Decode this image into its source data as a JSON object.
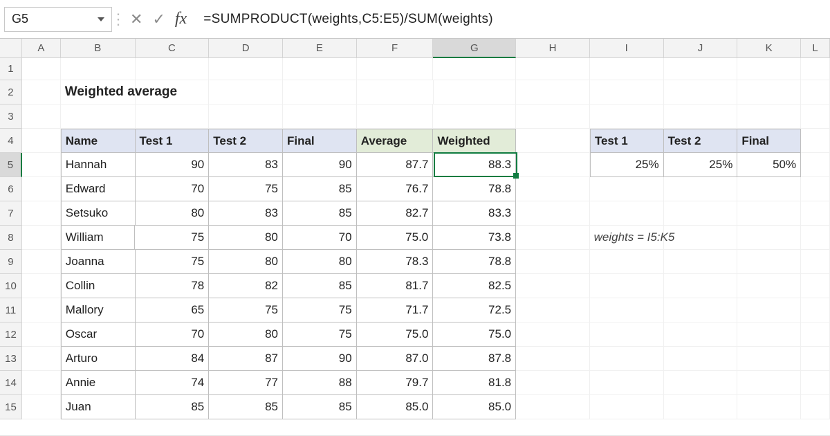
{
  "cell_ref": "G5",
  "formula": "=SUMPRODUCT(weights,C5:E5)/SUM(weights)",
  "columns": [
    "A",
    "B",
    "C",
    "D",
    "E",
    "F",
    "G",
    "H",
    "I",
    "J",
    "K",
    "L"
  ],
  "row_numbers": [
    "1",
    "2",
    "3",
    "4",
    "5",
    "6",
    "7",
    "8",
    "9",
    "10",
    "11",
    "12",
    "13",
    "14",
    "15"
  ],
  "title": "Weighted average",
  "main_headers": {
    "name": "Name",
    "t1": "Test 1",
    "t2": "Test 2",
    "fin": "Final",
    "avg": "Average",
    "wt": "Weighted"
  },
  "weights_headers": {
    "t1": "Test 1",
    "t2": "Test 2",
    "fin": "Final"
  },
  "weights_values": {
    "t1": "25%",
    "t2": "25%",
    "fin": "50%"
  },
  "note": "weights = I5:K5",
  "data": [
    {
      "name": "Hannah",
      "t1": "90",
      "t2": "83",
      "fin": "90",
      "avg": "87.7",
      "wt": "88.3"
    },
    {
      "name": "Edward",
      "t1": "70",
      "t2": "75",
      "fin": "85",
      "avg": "76.7",
      "wt": "78.8"
    },
    {
      "name": "Setsuko",
      "t1": "80",
      "t2": "83",
      "fin": "85",
      "avg": "82.7",
      "wt": "83.3"
    },
    {
      "name": "William",
      "t1": "75",
      "t2": "80",
      "fin": "70",
      "avg": "75.0",
      "wt": "73.8"
    },
    {
      "name": "Joanna",
      "t1": "75",
      "t2": "80",
      "fin": "80",
      "avg": "78.3",
      "wt": "78.8"
    },
    {
      "name": "Collin",
      "t1": "78",
      "t2": "82",
      "fin": "85",
      "avg": "81.7",
      "wt": "82.5"
    },
    {
      "name": "Mallory",
      "t1": "65",
      "t2": "75",
      "fin": "75",
      "avg": "71.7",
      "wt": "72.5"
    },
    {
      "name": "Oscar",
      "t1": "70",
      "t2": "80",
      "fin": "75",
      "avg": "75.0",
      "wt": "75.0"
    },
    {
      "name": "Arturo",
      "t1": "84",
      "t2": "87",
      "fin": "90",
      "avg": "87.0",
      "wt": "87.8"
    },
    {
      "name": "Annie",
      "t1": "74",
      "t2": "77",
      "fin": "88",
      "avg": "79.7",
      "wt": "81.8"
    },
    {
      "name": "Juan",
      "t1": "85",
      "t2": "85",
      "fin": "85",
      "avg": "85.0",
      "wt": "85.0"
    }
  ],
  "chart_data": {
    "type": "table",
    "title": "Weighted average",
    "columns": [
      "Name",
      "Test 1",
      "Test 2",
      "Final",
      "Average",
      "Weighted"
    ],
    "weights": {
      "Test 1": 0.25,
      "Test 2": 0.25,
      "Final": 0.5
    },
    "rows": [
      [
        "Hannah",
        90,
        83,
        90,
        87.7,
        88.3
      ],
      [
        "Edward",
        70,
        75,
        85,
        76.7,
        78.8
      ],
      [
        "Setsuko",
        80,
        83,
        85,
        82.7,
        83.3
      ],
      [
        "William",
        75,
        80,
        70,
        75.0,
        73.8
      ],
      [
        "Joanna",
        75,
        80,
        80,
        78.3,
        78.8
      ],
      [
        "Collin",
        78,
        82,
        85,
        81.7,
        82.5
      ],
      [
        "Mallory",
        65,
        75,
        75,
        71.7,
        72.5
      ],
      [
        "Oscar",
        70,
        80,
        75,
        75.0,
        75.0
      ],
      [
        "Arturo",
        84,
        87,
        90,
        87.0,
        87.8
      ],
      [
        "Annie",
        74,
        77,
        88,
        79.7,
        81.8
      ],
      [
        "Juan",
        85,
        85,
        85,
        85.0,
        85.0
      ]
    ]
  }
}
